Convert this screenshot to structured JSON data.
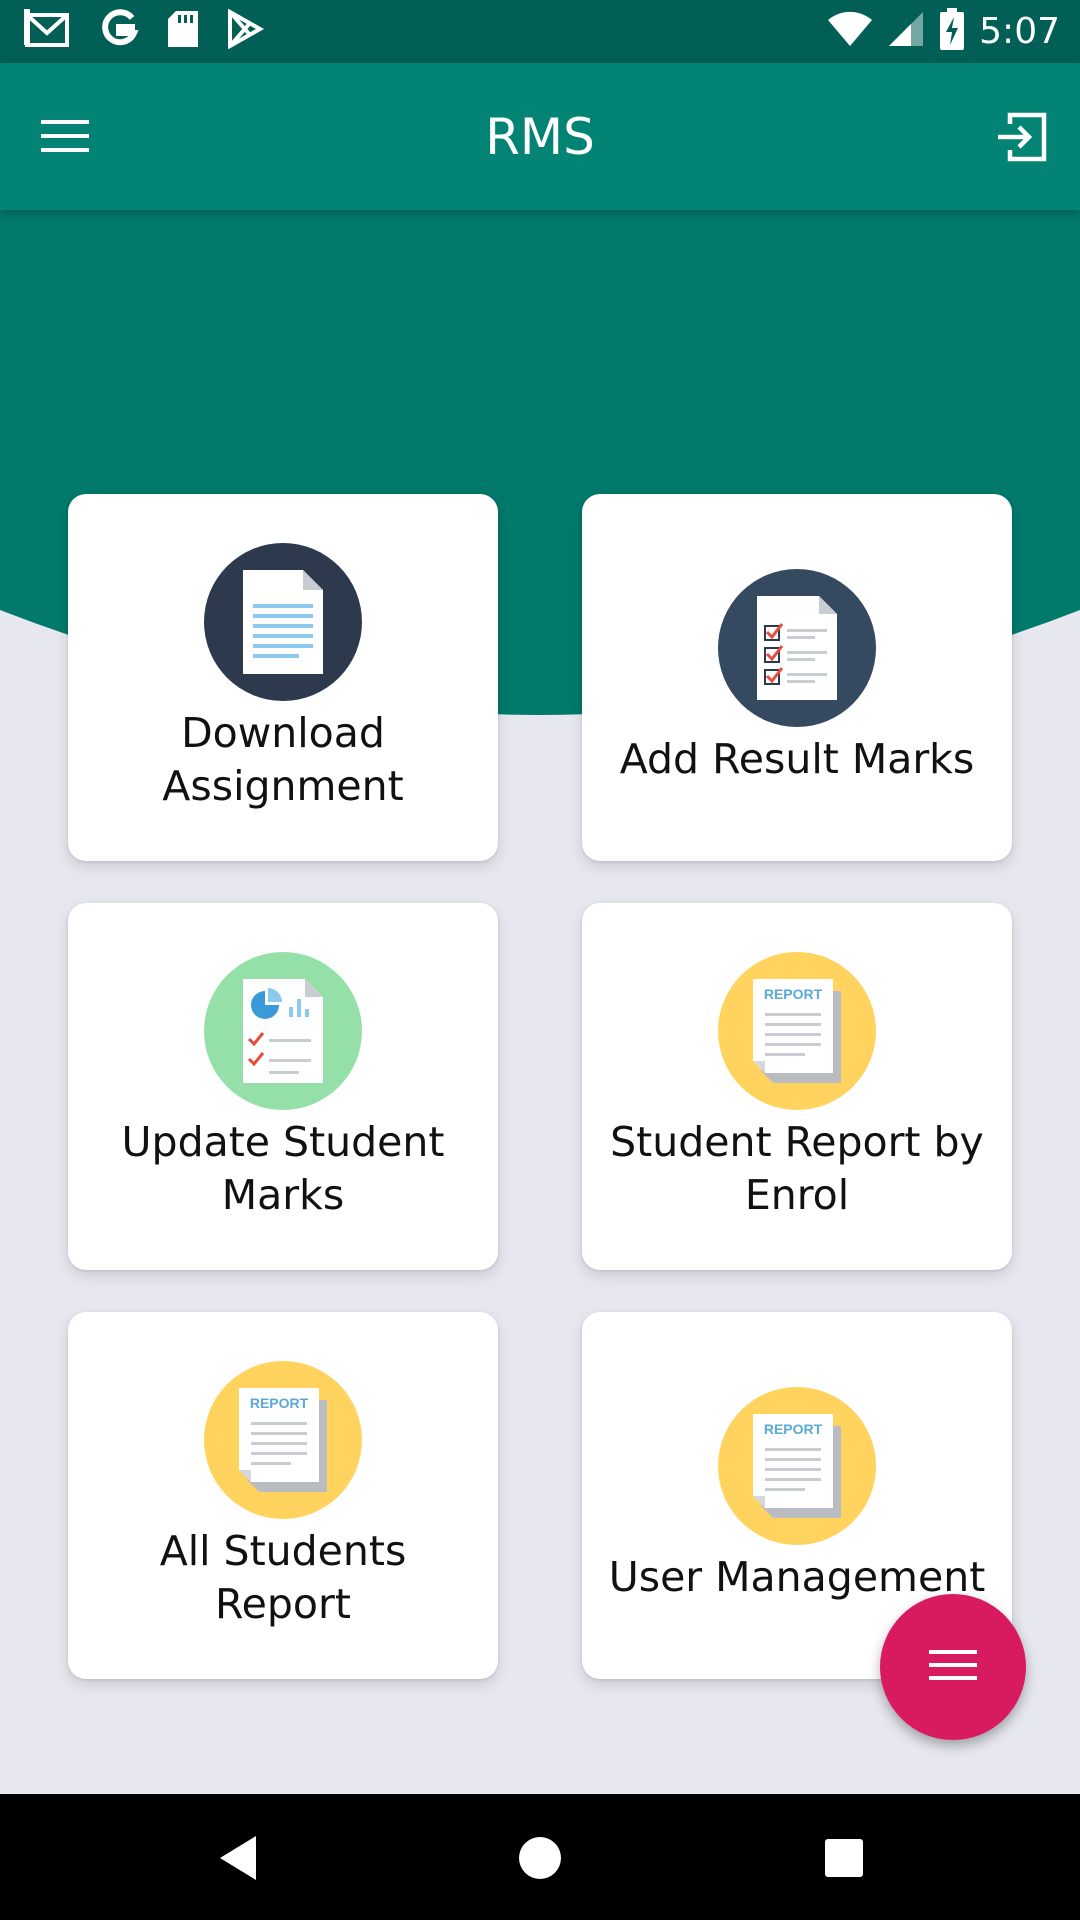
{
  "status_bar": {
    "time": "5:07",
    "icons": [
      "gmail-icon",
      "google-icon",
      "sd-card-icon",
      "play-store-icon",
      "wifi-icon",
      "signal-icon",
      "battery-charging-icon"
    ]
  },
  "app_bar": {
    "title": "RMS",
    "menu_icon": "hamburger-menu-icon",
    "logout_icon": "logout-icon"
  },
  "colors": {
    "status_bar": "#015f55",
    "app_bar": "#028373",
    "header_curve": "#01796b",
    "background": "#e7e7f0",
    "fab": "#d81b60"
  },
  "tiles": [
    {
      "label": "Download Assignment",
      "icon": "document-icon",
      "circle_color": "#2d3a4e"
    },
    {
      "label": "Add Result Marks",
      "icon": "checklist-icon",
      "circle_color": "#354a60"
    },
    {
      "label": "Update Student Marks",
      "icon": "chart-document-icon",
      "circle_color": "#94e0a8"
    },
    {
      "label": "Student Report by Enrol",
      "icon": "report-icon",
      "circle_color": "#ffd35e"
    },
    {
      "label": "All Students Report",
      "icon": "report-icon",
      "circle_color": "#ffd35e"
    },
    {
      "label": "User Management",
      "icon": "report-icon",
      "circle_color": "#ffd35e"
    }
  ],
  "fab": {
    "icon": "menu-icon"
  },
  "nav_bar": {
    "icons": [
      "back-icon",
      "home-icon",
      "recents-icon"
    ]
  }
}
